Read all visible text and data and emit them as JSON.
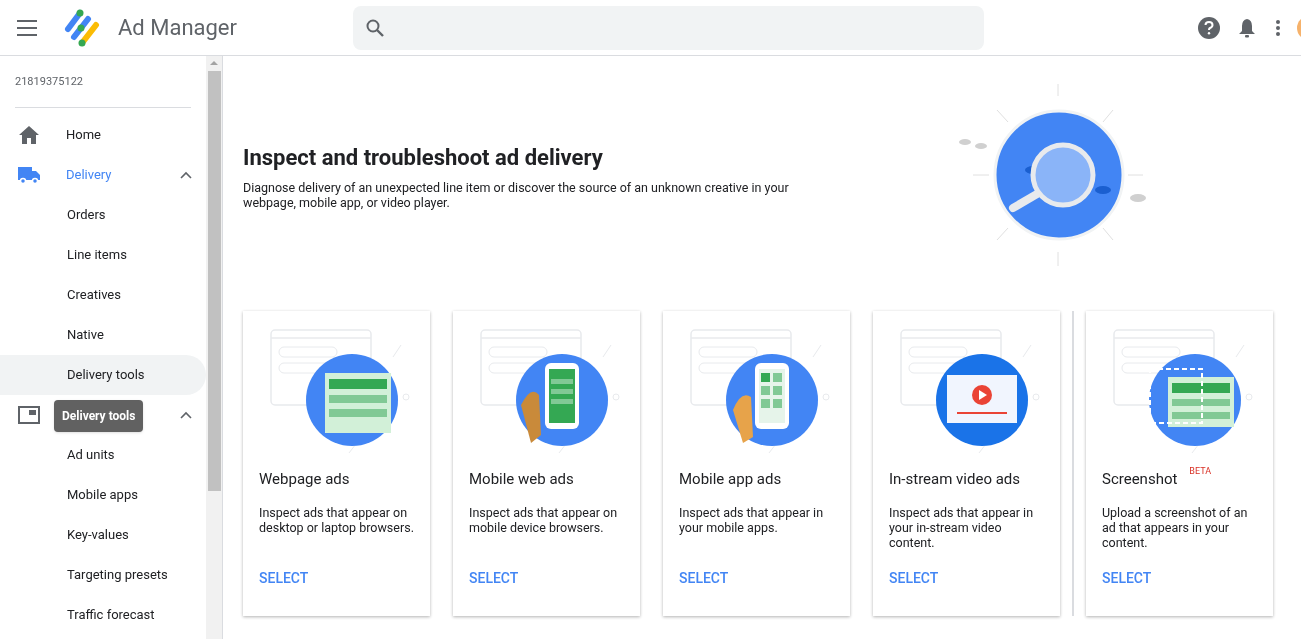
{
  "header": {
    "title": "Ad Manager"
  },
  "sidebar": {
    "account": "21819375122",
    "sections": [
      {
        "kind": "home",
        "label": "Home",
        "selected": false
      },
      {
        "kind": "delivery",
        "label": "Delivery",
        "selected": true,
        "expanded": true,
        "children": [
          {
            "label": "Orders",
            "selected": false
          },
          {
            "label": "Line items",
            "selected": false
          },
          {
            "label": "Creatives",
            "selected": false
          },
          {
            "label": "Native",
            "selected": false
          },
          {
            "label": "Delivery tools",
            "selected": true
          }
        ]
      },
      {
        "kind": "inventory",
        "selected": false,
        "expanded": true,
        "children": [
          {
            "label": "Ad units",
            "selected": false
          },
          {
            "label": "Mobile apps",
            "selected": false
          },
          {
            "label": "Key-values",
            "selected": false
          },
          {
            "label": "Targeting presets",
            "selected": false
          },
          {
            "label": "Traffic forecast",
            "selected": false
          }
        ]
      }
    ],
    "tooltip": "Delivery tools"
  },
  "hero": {
    "title": "Inspect and troubleshoot ad delivery",
    "description": "Diagnose delivery of an unexpected line item or discover the source of an unknown creative in your webpage, mobile app, or video player."
  },
  "cards": [
    {
      "kind": "webpage",
      "title": "Webpage ads",
      "description": "Inspect ads that appear on desktop or laptop browsers.",
      "action": "SELECT"
    },
    {
      "kind": "mobile_web",
      "title": "Mobile web ads",
      "description": "Inspect ads that appear on mobile device browsers.",
      "action": "SELECT"
    },
    {
      "kind": "mobile_app",
      "title": "Mobile app ads",
      "description": "Inspect ads that appear in your mobile apps.",
      "action": "SELECT"
    },
    {
      "kind": "video",
      "title": "In-stream video ads",
      "description": "Inspect ads that appear in your in-stream video content.",
      "action": "SELECT"
    },
    {
      "kind": "screenshot",
      "title": "Screenshot",
      "badge": "BETA",
      "description": "Upload a screenshot of an ad that appears in your content.",
      "action": "SELECT"
    }
  ]
}
